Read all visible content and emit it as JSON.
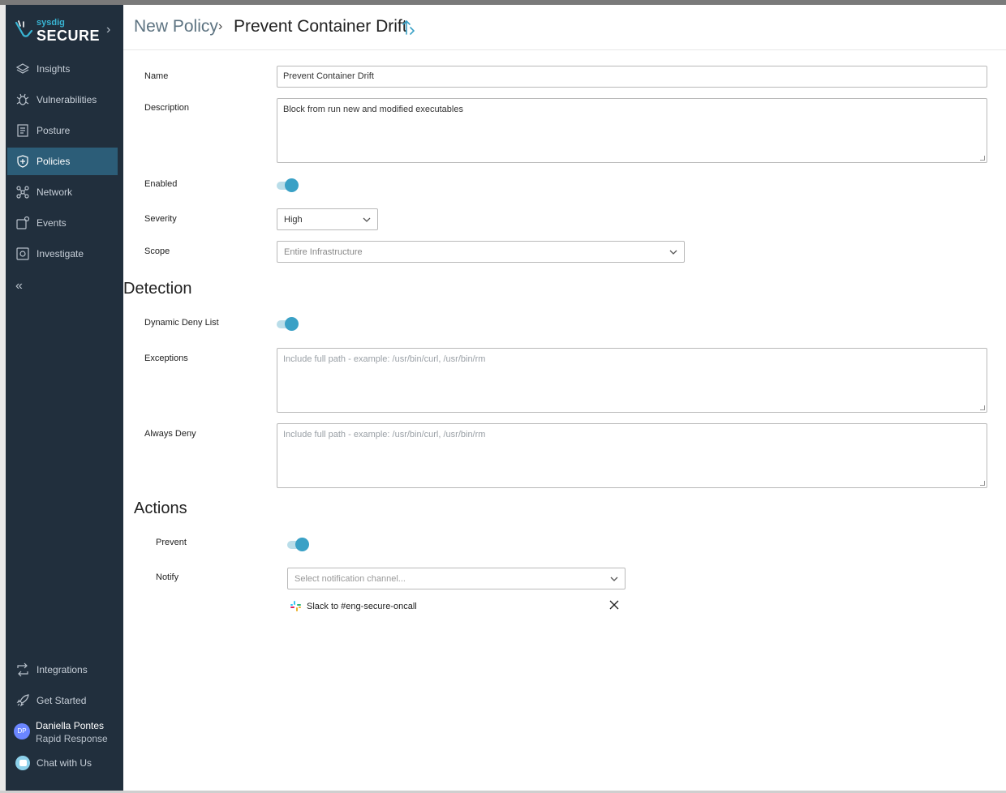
{
  "sidebar": {
    "brand_small": "sysdig",
    "brand_big": "SECURE",
    "items": [
      {
        "label": "Insights",
        "icon": "layers-icon"
      },
      {
        "label": "Vulnerabilities",
        "icon": "bug-icon"
      },
      {
        "label": "Posture",
        "icon": "checklist-icon"
      },
      {
        "label": "Policies",
        "icon": "shield-icon",
        "active": true
      },
      {
        "label": "Network",
        "icon": "network-icon"
      },
      {
        "label": "Events",
        "icon": "events-icon"
      },
      {
        "label": "Investigate",
        "icon": "investigate-icon"
      }
    ],
    "bottom": [
      {
        "label": "Integrations",
        "icon": "integrations-icon"
      },
      {
        "label": "Get Started",
        "icon": "rocket-icon"
      }
    ],
    "user": {
      "initials": "DP",
      "name": "Daniella Pontes",
      "role": "Rapid Response"
    },
    "chat_label": "Chat with Us"
  },
  "header": {
    "crumb_parent": "New Policy",
    "separator": "›",
    "crumb_current": "Prevent Container Drift"
  },
  "form": {
    "name_label": "Name",
    "name_value": "Prevent Container Drift",
    "description_label": "Description",
    "description_value": "Block from run new and modified executables",
    "enabled_label": "Enabled",
    "enabled_value": true,
    "severity_label": "Severity",
    "severity_value": "High",
    "scope_label": "Scope",
    "scope_value": "Entire Infrastructure"
  },
  "detection": {
    "title": "Detection",
    "deny_list_label": "Dynamic Deny List",
    "deny_list_value": true,
    "exceptions_label": "Exceptions",
    "exceptions_placeholder": "Include full path - example: /usr/bin/curl, /usr/bin/rm",
    "always_deny_label": "Always Deny",
    "always_deny_placeholder": "Include full path - example: /usr/bin/curl, /usr/bin/rm"
  },
  "actions": {
    "title": "Actions",
    "prevent_label": "Prevent",
    "prevent_value": true,
    "notify_label": "Notify",
    "notify_placeholder": "Select notification channel...",
    "channels": [
      "Slack to #eng-secure-oncall"
    ]
  },
  "colors": {
    "sidebar_bg": "#212f3d",
    "active_bg": "#2c5d78",
    "accent": "#3aa1c6"
  }
}
